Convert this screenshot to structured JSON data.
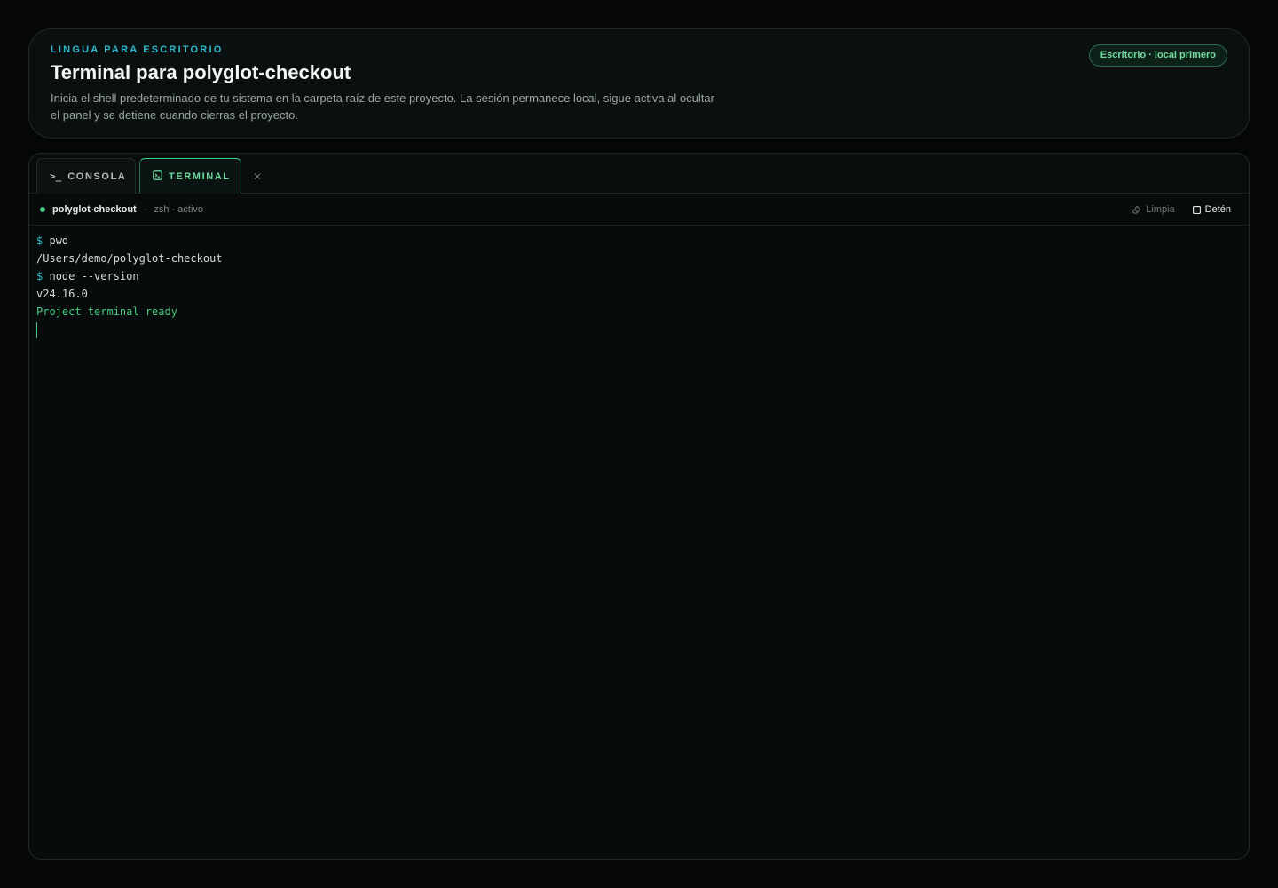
{
  "header": {
    "eyebrow": "LINGUA PARA ESCRITORIO",
    "title": "Terminal para polyglot-checkout",
    "description": "Inicia el shell predeterminado de tu sistema en la carpeta raíz de este proyecto. La sesión permanece local, sigue activa al ocultar el panel y se detiene cuando cierras el proyecto.",
    "badge": "Escritorio · local primero"
  },
  "tabs": [
    {
      "label": "CONSOLA",
      "icon": "console-prompt-icon",
      "active": false
    },
    {
      "label": "TERMINAL",
      "icon": "terminal-window-icon",
      "active": true
    }
  ],
  "status": {
    "project": "polyglot-checkout",
    "separator": "·",
    "shell": "zsh · activo",
    "clear_label": "Limpia",
    "stop_label": "Detén"
  },
  "terminal": {
    "prompt_symbol": "$",
    "lines": [
      {
        "type": "command",
        "text": "pwd"
      },
      {
        "type": "output",
        "text": "/Users/demo/polyglot-checkout"
      },
      {
        "type": "command",
        "text": "node --version"
      },
      {
        "type": "output",
        "text": "v24.16.0"
      },
      {
        "type": "success",
        "text": "Project terminal ready"
      }
    ]
  },
  "colors": {
    "accent_green": "#3fcf84",
    "accent_cyan": "#2bb8c9",
    "background": "#050707"
  }
}
